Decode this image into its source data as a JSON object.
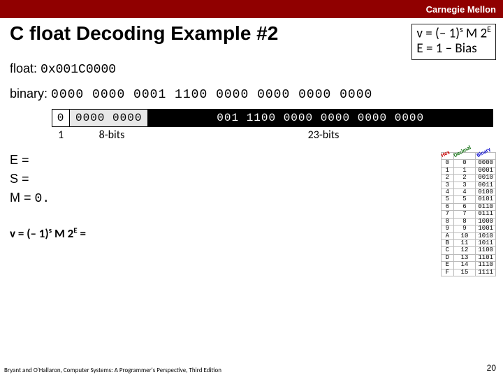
{
  "header": {
    "university": "Carnegie Mellon"
  },
  "title": "C float Decoding Example #2",
  "formula_top": {
    "line1_pre": "v = (– 1)",
    "line1_sup1": "s",
    "line1_mid": " M 2",
    "line1_sup2": "E",
    "line2": "E  =  1 – Bias"
  },
  "float_label": "float: ",
  "float_hex": "0x001C0000",
  "binary_label": "binary: ",
  "binary_groups": "0000 0000 0001 1100 0000 0000 0000 0000",
  "decode": {
    "sign": "0",
    "exp": "0000 0000",
    "frac": "001 1100 0000 0000 0000 0000"
  },
  "labels": {
    "sign": "1",
    "exp": "8-bits",
    "frac": "23-bits"
  },
  "eqs": {
    "E": "E =",
    "S": "S =",
    "M_pre": "M = ",
    "M_val": "0."
  },
  "formula_bottom": {
    "pre": "v = (– 1)",
    "sup1": "s",
    "mid": " M 2",
    "sup2": "E",
    "post": " ="
  },
  "hex_table": {
    "headers": [
      "Hex",
      "Decimal",
      "Binary"
    ],
    "rows": [
      [
        "0",
        "0",
        "0000"
      ],
      [
        "1",
        "1",
        "0001"
      ],
      [
        "2",
        "2",
        "0010"
      ],
      [
        "3",
        "3",
        "0011"
      ],
      [
        "4",
        "4",
        "0100"
      ],
      [
        "5",
        "5",
        "0101"
      ],
      [
        "6",
        "6",
        "0110"
      ],
      [
        "7",
        "7",
        "0111"
      ],
      [
        "8",
        "8",
        "1000"
      ],
      [
        "9",
        "9",
        "1001"
      ],
      [
        "A",
        "10",
        "1010"
      ],
      [
        "B",
        "11",
        "1011"
      ],
      [
        "C",
        "12",
        "1100"
      ],
      [
        "D",
        "13",
        "1101"
      ],
      [
        "E",
        "14",
        "1110"
      ],
      [
        "F",
        "15",
        "1111"
      ]
    ]
  },
  "footer": "Bryant and O'Hallaron, Computer Systems: A Programmer's Perspective, Third Edition",
  "pagenum": "20"
}
